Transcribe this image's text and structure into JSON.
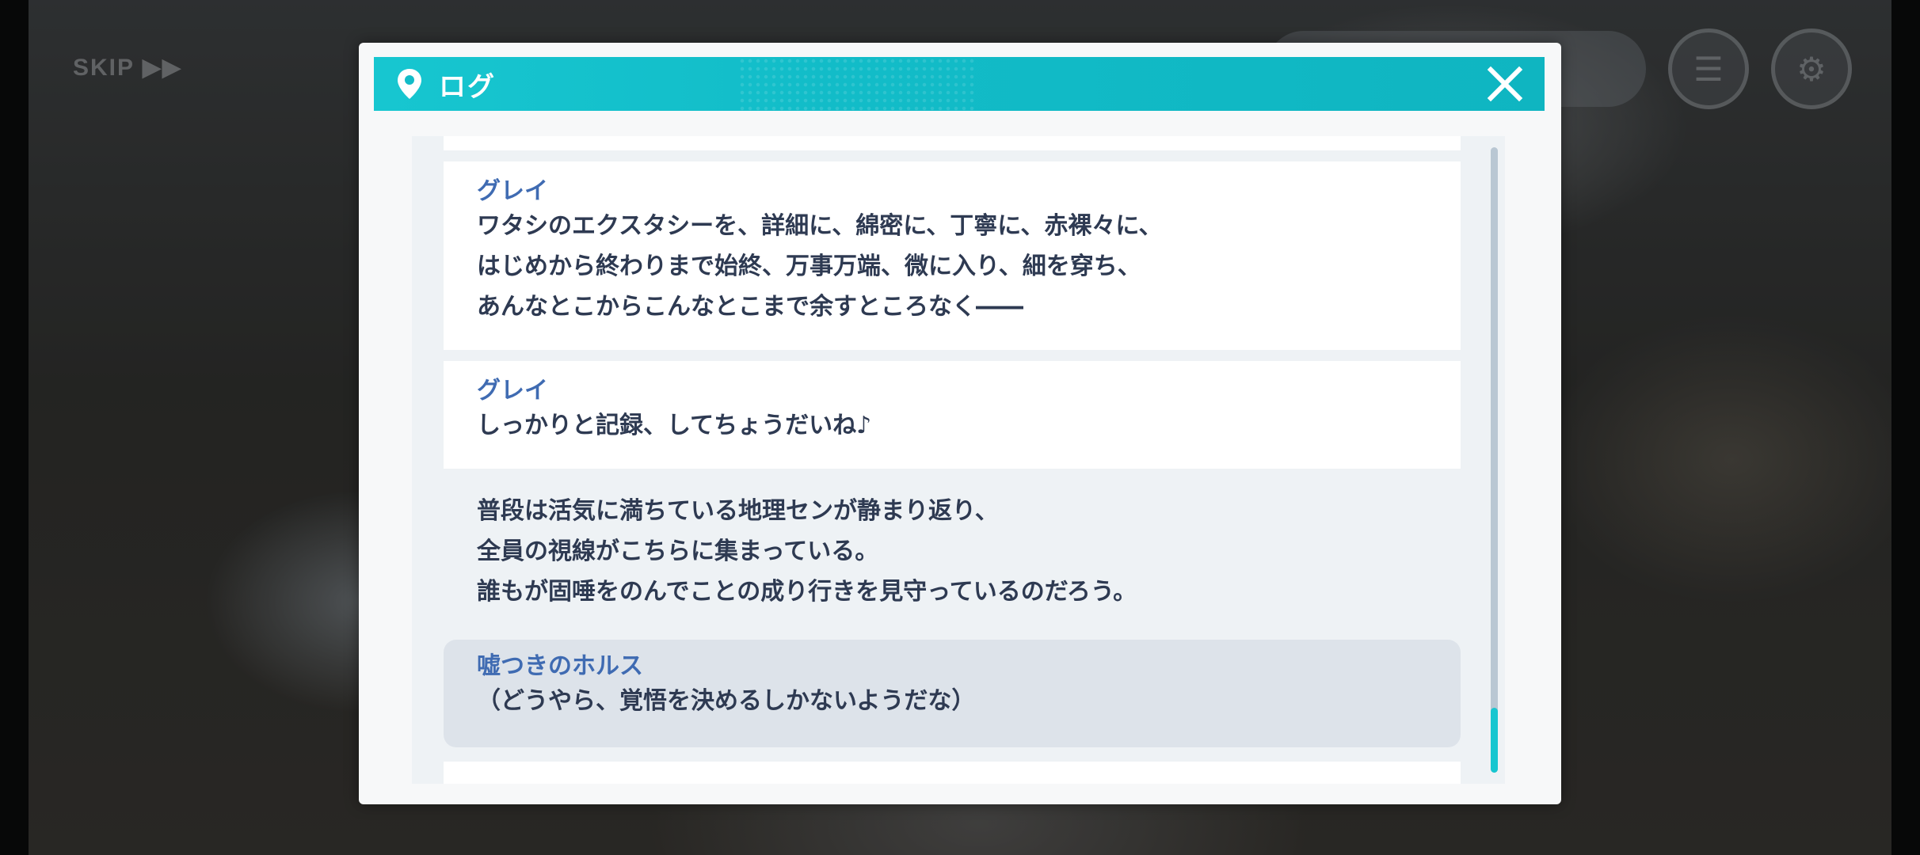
{
  "hud": {
    "skip_label": "SKIP ▶▶"
  },
  "log_dialog": {
    "title": "ログ",
    "entries": [
      {
        "speaker": "グレイ",
        "lines": [
          "ワタシのエクスタシーを、詳細に、綿密に、丁寧に、赤裸々に、",
          "はじめから終わりまで始終、万事万端、微に入り、細を穿ち、",
          "あんなとこからこんなとこまで余すところなく――"
        ]
      },
      {
        "speaker": "グレイ",
        "lines": [
          "しっかりと記録、してちょうだいね♪"
        ]
      },
      {
        "speaker": "",
        "lines": [
          "普段は活気に満ちている地理センが静まり返り、",
          "全員の視線がこちらに集まっている。",
          "誰もが固唾をのんでことの成り行きを見守っているのだろう。"
        ]
      },
      {
        "speaker": "嘘つきのホルス",
        "lines": [
          "（どうやら、覚悟を決めるしかないようだな）"
        ]
      }
    ],
    "scroll_position": 1.0
  },
  "colors": {
    "header": "#12bcc8",
    "speaker_name": "#3f6bb2",
    "body_text": "#2e3a52",
    "highlight_entry": "#dde3ea",
    "scroll_thumb": "#17c6d0"
  }
}
